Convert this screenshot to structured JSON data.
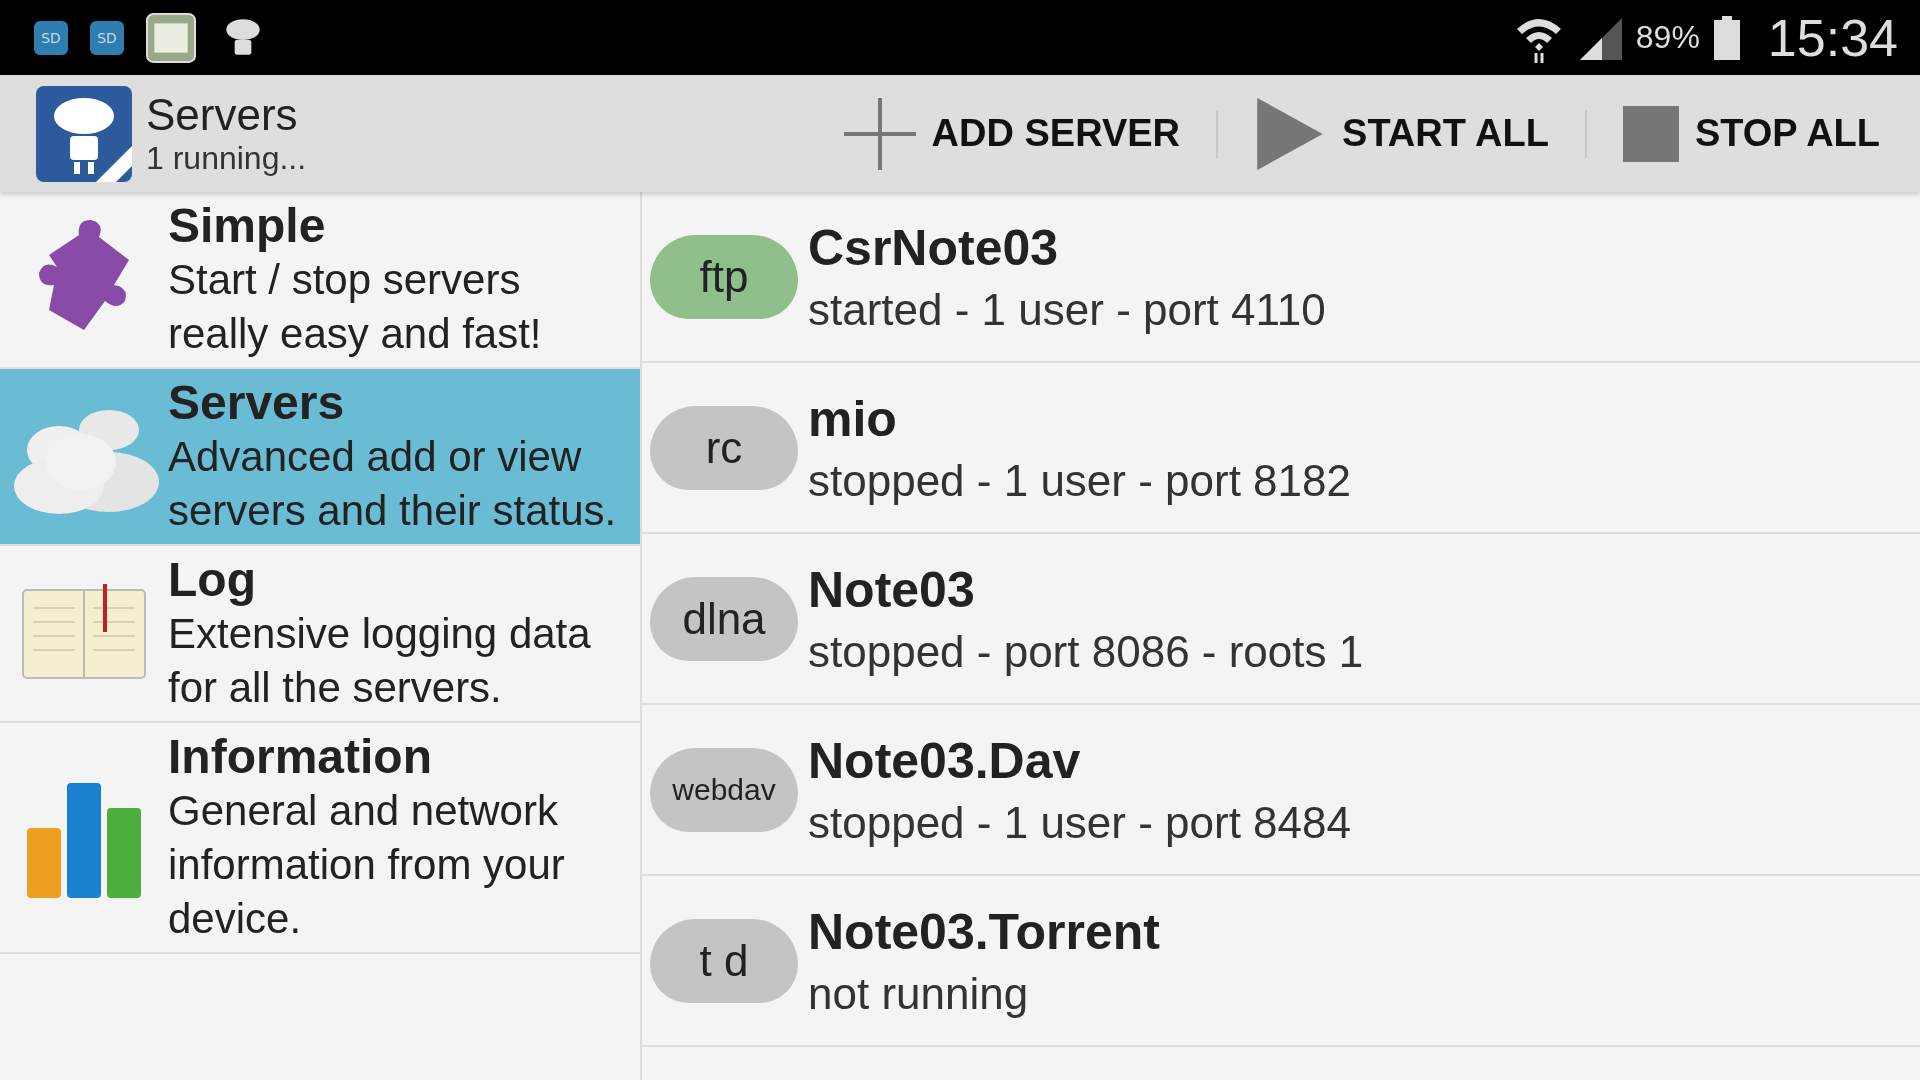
{
  "status_bar": {
    "notifications": [
      "SD",
      "SD"
    ],
    "battery": "89%",
    "time": "15:34"
  },
  "action_bar": {
    "title": "Servers",
    "subtitle": "1 running...",
    "actions": [
      {
        "kind": "add",
        "label": "ADD SERVER"
      },
      {
        "kind": "start",
        "label": "START ALL"
      },
      {
        "kind": "stop",
        "label": "STOP ALL"
      }
    ]
  },
  "sidebar": {
    "items": [
      {
        "kind": "puzzle",
        "title": "Simple",
        "description": "Start / stop servers really easy and fast!",
        "selected": false
      },
      {
        "kind": "clouds",
        "title": "Servers",
        "description": "Advanced add or view servers and their status.",
        "selected": true
      },
      {
        "kind": "book",
        "title": "Log",
        "description": "Extensive logging data for all the servers.",
        "selected": false
      },
      {
        "kind": "chart",
        "title": "Information",
        "description": "General and network information from your device.",
        "selected": false
      }
    ]
  },
  "servers": [
    {
      "badge": "ftp",
      "name": "CsrNote03",
      "status": "started - 1 user - port 4110",
      "running": true
    },
    {
      "badge": "rc",
      "name": "mio",
      "status": "stopped - 1 user - port 8182",
      "running": false
    },
    {
      "badge": "dlna",
      "name": "Note03",
      "status": "stopped - port 8086 - roots 1",
      "running": false
    },
    {
      "badge": "webdav",
      "name": "Note03.Dav",
      "status": "stopped - 1 user - port 8484",
      "running": false
    },
    {
      "badge": "t d",
      "name": "Note03.Torrent",
      "status": "not running",
      "running": false
    }
  ]
}
